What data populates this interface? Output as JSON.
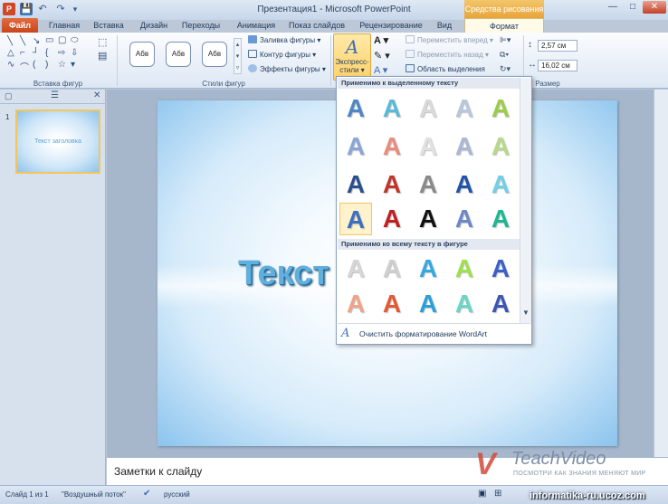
{
  "window": {
    "title": "Презентация1 - Microsoft PowerPoint",
    "contextual_header": "Средства рисования",
    "controls": {
      "minimize": "—",
      "maximize": "□",
      "close": "✕"
    }
  },
  "quick_access": {
    "app_letter": "P",
    "save": "💾",
    "undo": "↶",
    "redo": "↷",
    "more": "▾"
  },
  "tabs": [
    "Файл",
    "Главная",
    "Вставка",
    "Дизайн",
    "Переходы",
    "Анимация",
    "Показ слайдов",
    "Рецензирование",
    "Вид",
    "Формат"
  ],
  "ribbon": {
    "groups": {
      "insert_shapes": "Вставка фигур",
      "shape_styles": "Стили фигур",
      "size": "Размер"
    },
    "style_sample": "Абв",
    "commands": {
      "fill": "Заливка фигуры",
      "outline": "Контур фигуры",
      "effects": "Эффекты фигуры",
      "bring_forward": "Переместить вперед",
      "send_backward": "Переместить назад",
      "selection_pane": "Область выделения"
    },
    "express_label_1": "Экспресс-",
    "express_label_2": "стили",
    "height_value": "2,57 см",
    "width_value": "16,02 см"
  },
  "slides_pane": {
    "slide_number": "1",
    "thumbnail_text": "Текст заголовка"
  },
  "slide": {
    "title_visible": "Текст"
  },
  "notes": {
    "placeholder": "Заметки к слайду"
  },
  "watermark": {
    "mark": "V",
    "name": "TeachVideo",
    "slogan": "ПОСМОТРИ КАК ЗНАНИЯ МЕНЯЮТ МИР"
  },
  "status": {
    "slide_info": "Слайд 1 из 1",
    "theme": "\"Воздушный поток\"",
    "language": "русский",
    "site": "informatika-ru.ucoz.com"
  },
  "gallery": {
    "section_selected": "Применимо к выделенному тексту",
    "section_all": "Применимо ко всему тексту в фигуре",
    "clear_label": "Очистить форматирование WordArt",
    "letter": "A",
    "colors": {
      "row1": [
        "#4f86c6",
        "#5bb9d8",
        "#d9d9d9",
        "#b9c7dc",
        "#9ccc4a"
      ],
      "row2": [
        "#8aa6d6",
        "#e98b7d",
        "#e1e1e1",
        "#a8b8d6",
        "#b8d98a"
      ],
      "row3": [
        "#2a4f8f",
        "#c0342b",
        "#8a8a8a",
        "#2255a8",
        "#6fd0e6"
      ],
      "row4": [
        "#3b6fc4",
        "#c01f1f",
        "#111111",
        "#6d87c9",
        "#1bb893"
      ],
      "row5": [
        "#d6d6d6",
        "#cfcfcf",
        "#35a8e0",
        "#9fe04f",
        "#3a62c6"
      ],
      "row6": [
        "#f0a487",
        "#e05a33",
        "#2aa0da",
        "#68d6c4",
        "#3d56b3"
      ]
    }
  }
}
